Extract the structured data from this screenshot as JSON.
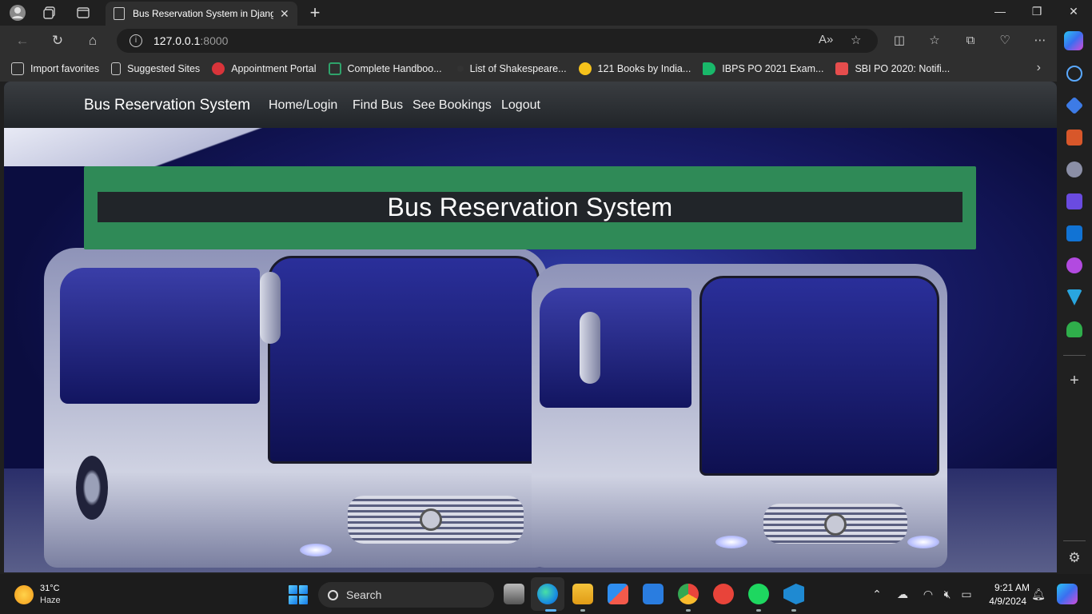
{
  "browser": {
    "tab": {
      "title": "Bus Reservation System in Django"
    },
    "address": {
      "host": "127.0.0.1",
      "port": ":8000"
    },
    "favorites": [
      {
        "label": "Import favorites",
        "icon": "import-icon"
      },
      {
        "label": "Suggested Sites",
        "icon": "page-icon"
      },
      {
        "label": "Appointment Portal",
        "icon": "portal-icon"
      },
      {
        "label": "Complete Handboo...",
        "icon": "handbook-icon"
      },
      {
        "label": "List of Shakespeare...",
        "icon": "dot-icon"
      },
      {
        "label": "121 Books by India...",
        "icon": "books-icon"
      },
      {
        "label": "IBPS PO 2021 Exam...",
        "icon": "flag-icon"
      },
      {
        "label": "SBI PO 2020: Notifi...",
        "icon": "sbi-icon"
      }
    ]
  },
  "site": {
    "brand": "Bus Reservation System",
    "nav": [
      "Home/Login",
      "Find Bus",
      "See Bookings",
      "Logout"
    ],
    "hero_title": "Bus Reservation System",
    "colors": {
      "banner": "#2f8a57",
      "banner_inner": "#212529",
      "navbar": "#212529"
    }
  },
  "taskbar": {
    "weather": {
      "temp": "31°C",
      "condition": "Haze"
    },
    "search_label": "Search",
    "clock": {
      "time": "9:21 AM",
      "date": "4/9/2024"
    }
  }
}
